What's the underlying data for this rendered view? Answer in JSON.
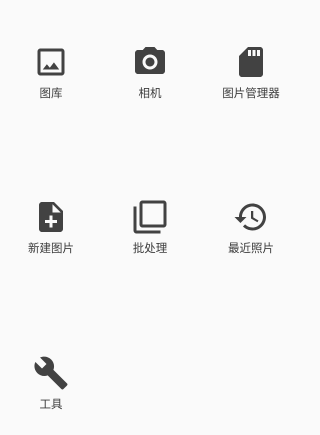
{
  "grid": {
    "items": [
      {
        "label": "图库",
        "icon": "image-icon"
      },
      {
        "label": "相机",
        "icon": "camera-icon"
      },
      {
        "label": "图片管理器",
        "icon": "sd-card-icon"
      },
      {
        "label": "新建图片",
        "icon": "new-file-icon"
      },
      {
        "label": "批处理",
        "icon": "batch-copy-icon"
      },
      {
        "label": "最近照片",
        "icon": "history-icon"
      },
      {
        "label": "工具",
        "icon": "wrench-icon"
      }
    ]
  },
  "colors": {
    "background": "#fafafa",
    "icon": "#424242",
    "text": "#3c3c3c"
  }
}
